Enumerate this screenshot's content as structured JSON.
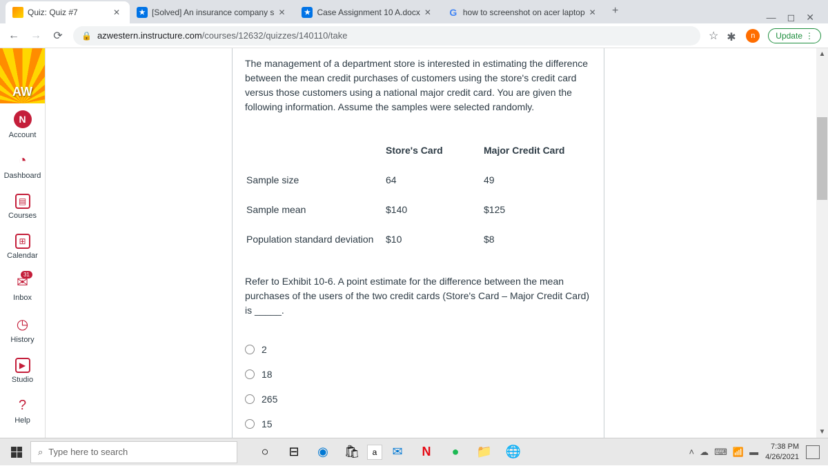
{
  "browser": {
    "tabs": [
      {
        "title": "Quiz: Quiz #7",
        "favicon": "canvas"
      },
      {
        "title": "[Solved] An insurance company s",
        "favicon": "cc"
      },
      {
        "title": "Case Assignment 10 A.docx",
        "favicon": "cc"
      },
      {
        "title": "how to screenshot on acer laptop",
        "favicon": "g"
      }
    ],
    "url_domain": "azwestern.instructure.com",
    "url_path": "/courses/12632/quizzes/140110/take",
    "update_label": "Update",
    "profile_initial": "n"
  },
  "sidebar": {
    "logo_text": "AW",
    "items": [
      {
        "label": "Account",
        "icon": "N"
      },
      {
        "label": "Dashboard",
        "icon": "dash"
      },
      {
        "label": "Courses",
        "icon": "book"
      },
      {
        "label": "Calendar",
        "icon": "cal"
      },
      {
        "label": "Inbox",
        "icon": "inbox"
      },
      {
        "label": "History",
        "icon": "clock"
      },
      {
        "label": "Studio",
        "icon": "studio"
      },
      {
        "label": "Help",
        "icon": "help"
      }
    ]
  },
  "question": {
    "intro": "The management of a department store is interested in estimating the difference between the mean credit purchases of customers using the store's credit card versus those customers using a national major credit card. You are given the following information. Assume the samples were selected randomly.",
    "table": {
      "headers": [
        "",
        "Store's Card",
        "Major Credit Card"
      ],
      "rows": [
        {
          "label": "Sample size",
          "c1": "64",
          "c2": "49"
        },
        {
          "label": "Sample mean",
          "c1": "$140",
          "c2": "$125"
        },
        {
          "label": "Population standard deviation",
          "c1": "$10",
          "c2": "$8"
        }
      ]
    },
    "prompt": "Refer to Exhibit 10-6. A point estimate for the difference between the mean purchases of the users of the two credit cards (Store's Card – Major Credit Card) is _____.",
    "options": [
      "2",
      "18",
      "265",
      "15"
    ]
  },
  "taskbar": {
    "search_placeholder": "Type here to search",
    "time": "7:38 PM",
    "date": "4/26/2021"
  }
}
